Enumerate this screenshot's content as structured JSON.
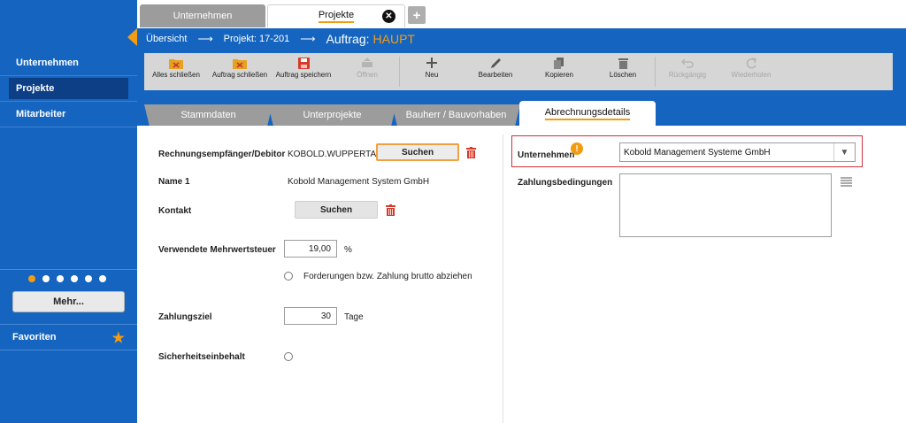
{
  "sidebar": {
    "items": [
      {
        "label": "Unternehmen"
      },
      {
        "label": "Projekte"
      },
      {
        "label": "Mitarbeiter"
      }
    ],
    "more_label": "Mehr...",
    "favorites_label": "Favoriten"
  },
  "tabs": {
    "companies": "Unternehmen",
    "projects": "Projekte"
  },
  "breadcrumb": {
    "overview": "Übersicht",
    "project": "Projekt: 17-201",
    "order_label": "Auftrag:",
    "order_value": "HAUPT"
  },
  "toolbar": {
    "close_all": "Alles schließen",
    "close_order": "Auftrag schließen",
    "save_order": "Auftrag speichern",
    "open": "Öffnen",
    "new": "Neu",
    "edit": "Bearbeiten",
    "copy": "Kopieren",
    "delete": "Löschen",
    "undo": "Rückgängig",
    "redo": "Wiederholen"
  },
  "subtabs": {
    "master": "Stammdaten",
    "subprojects": "Unterprojekte",
    "client": "Bauherr / Bauvorhaben",
    "billing": "Abrechnungsdetails"
  },
  "form": {
    "invoice_recipient_label": "Rechnungsempfänger/Debitor",
    "invoice_recipient_value": "KOBOLD.WUPPERTAL",
    "search_label": "Suchen",
    "name1_label": "Name 1",
    "name1_value": "Kobold Management System GmbH",
    "contact_label": "Kontakt",
    "contact_search_label": "Suchen",
    "vat_label": "Verwendete Mehrwertsteuer",
    "vat_value": "19,00",
    "vat_unit": "%",
    "gross_option": "Forderungen bzw. Zahlung brutto abziehen",
    "payment_target_label": "Zahlungsziel",
    "payment_target_value": "30",
    "payment_target_unit": "Tage",
    "retention_label": "Sicherheitseinbehalt",
    "company_label": "Unternehmen",
    "company_value": "Kobold Management Systeme GmbH",
    "payment_terms_label": "Zahlungsbedingungen"
  },
  "colors": {
    "primary": "#1565c0",
    "accent": "#f39c12",
    "highlight_border": "#d0303b"
  }
}
